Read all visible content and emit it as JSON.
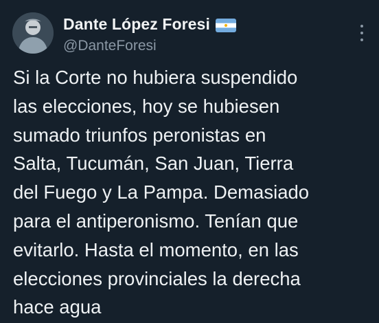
{
  "author": {
    "display_name": "Dante López Foresi",
    "handle": "@DanteForesi",
    "flag_icon": "argentina-flag-icon",
    "avatar_icon": "profile-avatar"
  },
  "menu": {
    "more_icon": "more-options-vertical-icon"
  },
  "tweet": {
    "text": "Si la Corte no hubiera suspendido\nlas elecciones, hoy se hubiesen\nsumado triunfos peronistas en\nSalta, Tucumán, San Juan, Tierra\ndel Fuego y La Pampa. Demasiado\npara el antiperonismo. Tenían que\nevitarlo. Hasta el momento, en las\nelecciones provinciales la derecha\nhace agua"
  },
  "colors": {
    "background": "#15202b",
    "text": "#eef1f3",
    "secondary_text": "#8b98a5",
    "flag_blue": "#74acdf",
    "flag_white": "#ffffff",
    "flag_sun": "#f6b40e"
  }
}
